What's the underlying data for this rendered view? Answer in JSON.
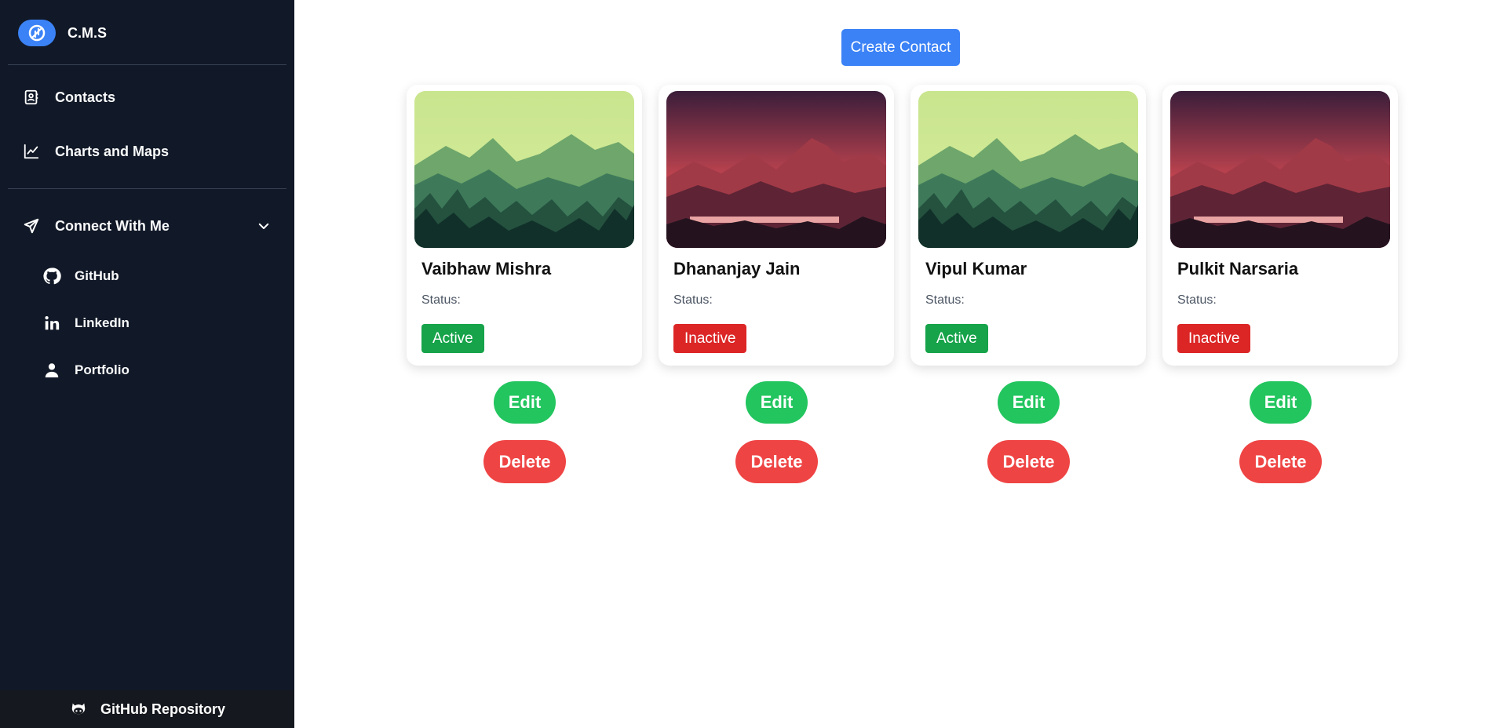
{
  "brand": {
    "title": "C.M.S",
    "icon": "brand-logo-icon",
    "accent": "#3b82f6"
  },
  "nav": [
    {
      "label": "Contacts",
      "icon": "contact-book-icon"
    },
    {
      "label": "Charts and Maps",
      "icon": "line-chart-icon"
    }
  ],
  "connect": {
    "label": "Connect With Me",
    "icon": "send-icon",
    "expand_icon": "chevron-down-icon",
    "items": [
      {
        "label": "GitHub",
        "icon": "github-icon"
      },
      {
        "label": "LinkedIn",
        "icon": "linkedin-icon"
      },
      {
        "label": "Portfolio",
        "icon": "user-icon"
      }
    ]
  },
  "footer": {
    "label": "GitHub Repository",
    "icon": "github-octocat-icon"
  },
  "main": {
    "create_label": "Create Contact",
    "status_label": "Status:",
    "edit_label": "Edit",
    "delete_label": "Delete"
  },
  "contacts": [
    {
      "name": "Vaibhaw Mishra",
      "status": "Active",
      "image": "green-forest-landscape"
    },
    {
      "name": "Dhananjay Jain",
      "status": "Inactive",
      "image": "red-mountain-lake-landscape"
    },
    {
      "name": "Vipul Kumar",
      "status": "Active",
      "image": "green-forest-landscape"
    },
    {
      "name": "Pulkit Narsaria",
      "status": "Inactive",
      "image": "red-mountain-lake-landscape"
    }
  ],
  "colors": {
    "sidebar_bg": "#111827",
    "active": "#16a34a",
    "inactive": "#dc2626",
    "edit": "#22c55e",
    "delete": "#ef4444",
    "create": "#3b82f6"
  }
}
